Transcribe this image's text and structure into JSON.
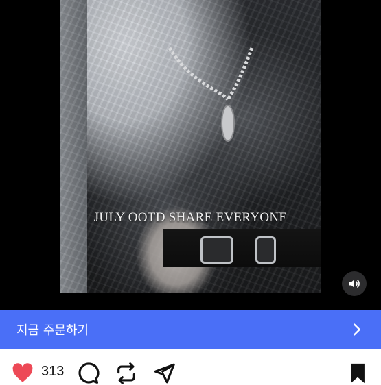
{
  "video": {
    "overlay_caption": "JULY OOTD SHARE EVERYONE",
    "sound_icon": "speaker-volume-icon"
  },
  "order_bar": {
    "label": "지금 주문하기",
    "icon": "chevron-right-icon",
    "background": "#4a6ff7"
  },
  "actions": {
    "like_count": "313",
    "like_color": "#ed4956",
    "icons": [
      "heart-icon",
      "comment-icon",
      "repost-icon",
      "share-icon",
      "bookmark-icon"
    ]
  }
}
